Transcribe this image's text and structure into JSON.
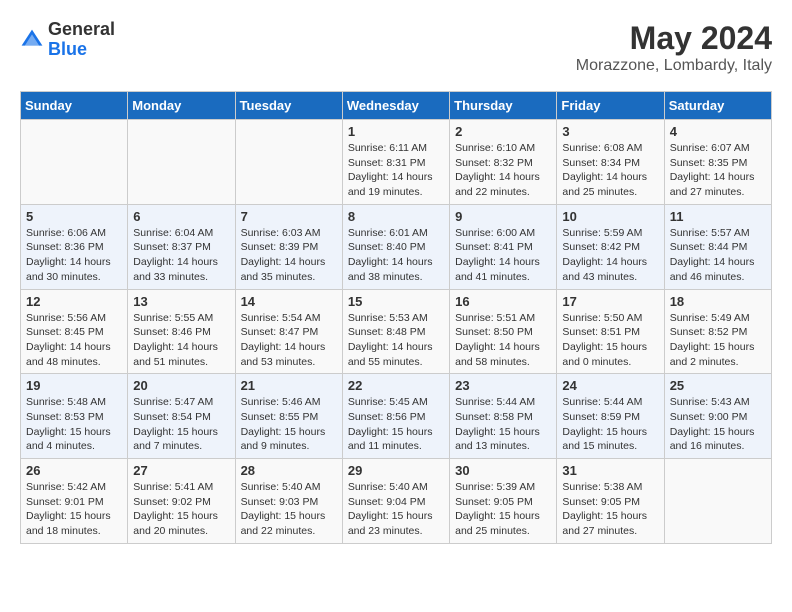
{
  "header": {
    "logo_general": "General",
    "logo_blue": "Blue",
    "month_year": "May 2024",
    "location": "Morazzone, Lombardy, Italy"
  },
  "calendar": {
    "days_of_week": [
      "Sunday",
      "Monday",
      "Tuesday",
      "Wednesday",
      "Thursday",
      "Friday",
      "Saturday"
    ],
    "weeks": [
      [
        {
          "day": "",
          "info": ""
        },
        {
          "day": "",
          "info": ""
        },
        {
          "day": "",
          "info": ""
        },
        {
          "day": "1",
          "info": "Sunrise: 6:11 AM\nSunset: 8:31 PM\nDaylight: 14 hours\nand 19 minutes."
        },
        {
          "day": "2",
          "info": "Sunrise: 6:10 AM\nSunset: 8:32 PM\nDaylight: 14 hours\nand 22 minutes."
        },
        {
          "day": "3",
          "info": "Sunrise: 6:08 AM\nSunset: 8:34 PM\nDaylight: 14 hours\nand 25 minutes."
        },
        {
          "day": "4",
          "info": "Sunrise: 6:07 AM\nSunset: 8:35 PM\nDaylight: 14 hours\nand 27 minutes."
        }
      ],
      [
        {
          "day": "5",
          "info": "Sunrise: 6:06 AM\nSunset: 8:36 PM\nDaylight: 14 hours\nand 30 minutes."
        },
        {
          "day": "6",
          "info": "Sunrise: 6:04 AM\nSunset: 8:37 PM\nDaylight: 14 hours\nand 33 minutes."
        },
        {
          "day": "7",
          "info": "Sunrise: 6:03 AM\nSunset: 8:39 PM\nDaylight: 14 hours\nand 35 minutes."
        },
        {
          "day": "8",
          "info": "Sunrise: 6:01 AM\nSunset: 8:40 PM\nDaylight: 14 hours\nand 38 minutes."
        },
        {
          "day": "9",
          "info": "Sunrise: 6:00 AM\nSunset: 8:41 PM\nDaylight: 14 hours\nand 41 minutes."
        },
        {
          "day": "10",
          "info": "Sunrise: 5:59 AM\nSunset: 8:42 PM\nDaylight: 14 hours\nand 43 minutes."
        },
        {
          "day": "11",
          "info": "Sunrise: 5:57 AM\nSunset: 8:44 PM\nDaylight: 14 hours\nand 46 minutes."
        }
      ],
      [
        {
          "day": "12",
          "info": "Sunrise: 5:56 AM\nSunset: 8:45 PM\nDaylight: 14 hours\nand 48 minutes."
        },
        {
          "day": "13",
          "info": "Sunrise: 5:55 AM\nSunset: 8:46 PM\nDaylight: 14 hours\nand 51 minutes."
        },
        {
          "day": "14",
          "info": "Sunrise: 5:54 AM\nSunset: 8:47 PM\nDaylight: 14 hours\nand 53 minutes."
        },
        {
          "day": "15",
          "info": "Sunrise: 5:53 AM\nSunset: 8:48 PM\nDaylight: 14 hours\nand 55 minutes."
        },
        {
          "day": "16",
          "info": "Sunrise: 5:51 AM\nSunset: 8:50 PM\nDaylight: 14 hours\nand 58 minutes."
        },
        {
          "day": "17",
          "info": "Sunrise: 5:50 AM\nSunset: 8:51 PM\nDaylight: 15 hours\nand 0 minutes."
        },
        {
          "day": "18",
          "info": "Sunrise: 5:49 AM\nSunset: 8:52 PM\nDaylight: 15 hours\nand 2 minutes."
        }
      ],
      [
        {
          "day": "19",
          "info": "Sunrise: 5:48 AM\nSunset: 8:53 PM\nDaylight: 15 hours\nand 4 minutes."
        },
        {
          "day": "20",
          "info": "Sunrise: 5:47 AM\nSunset: 8:54 PM\nDaylight: 15 hours\nand 7 minutes."
        },
        {
          "day": "21",
          "info": "Sunrise: 5:46 AM\nSunset: 8:55 PM\nDaylight: 15 hours\nand 9 minutes."
        },
        {
          "day": "22",
          "info": "Sunrise: 5:45 AM\nSunset: 8:56 PM\nDaylight: 15 hours\nand 11 minutes."
        },
        {
          "day": "23",
          "info": "Sunrise: 5:44 AM\nSunset: 8:58 PM\nDaylight: 15 hours\nand 13 minutes."
        },
        {
          "day": "24",
          "info": "Sunrise: 5:44 AM\nSunset: 8:59 PM\nDaylight: 15 hours\nand 15 minutes."
        },
        {
          "day": "25",
          "info": "Sunrise: 5:43 AM\nSunset: 9:00 PM\nDaylight: 15 hours\nand 16 minutes."
        }
      ],
      [
        {
          "day": "26",
          "info": "Sunrise: 5:42 AM\nSunset: 9:01 PM\nDaylight: 15 hours\nand 18 minutes."
        },
        {
          "day": "27",
          "info": "Sunrise: 5:41 AM\nSunset: 9:02 PM\nDaylight: 15 hours\nand 20 minutes."
        },
        {
          "day": "28",
          "info": "Sunrise: 5:40 AM\nSunset: 9:03 PM\nDaylight: 15 hours\nand 22 minutes."
        },
        {
          "day": "29",
          "info": "Sunrise: 5:40 AM\nSunset: 9:04 PM\nDaylight: 15 hours\nand 23 minutes."
        },
        {
          "day": "30",
          "info": "Sunrise: 5:39 AM\nSunset: 9:05 PM\nDaylight: 15 hours\nand 25 minutes."
        },
        {
          "day": "31",
          "info": "Sunrise: 5:38 AM\nSunset: 9:05 PM\nDaylight: 15 hours\nand 27 minutes."
        },
        {
          "day": "",
          "info": ""
        }
      ]
    ]
  }
}
